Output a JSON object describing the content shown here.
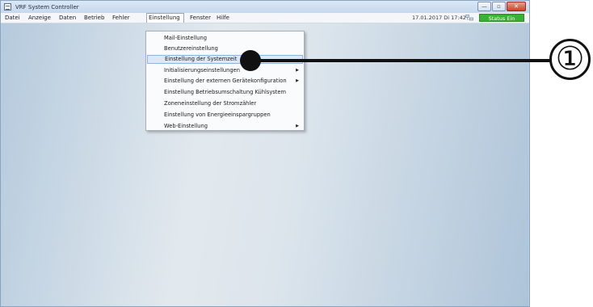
{
  "window": {
    "title": "VRF System Controller"
  },
  "window_controls": {
    "minimize": "—",
    "maximize": "▫",
    "close": "✕"
  },
  "menubar": {
    "items": [
      "Datei",
      "Anzeige",
      "Daten",
      "Betrieb",
      "Fehler",
      "Einstellung",
      "Fenster",
      "Hilfe"
    ],
    "open_item": "Einstellung"
  },
  "datetime": "17.01.2017 Di 17:42",
  "status": {
    "label": "Status Ein",
    "color": "#37b233"
  },
  "dropdown": {
    "items": [
      {
        "label": "Mail-Einstellung",
        "submenu": false
      },
      {
        "label": "Benutzereinstellung",
        "submenu": false
      },
      {
        "label": "Einstellung der Systemzeit",
        "submenu": false,
        "highlighted": true
      },
      {
        "label": "Initialisierungseinstellungen",
        "submenu": true
      },
      {
        "label": "Einstellung der externen Gerätekonfiguration",
        "submenu": true
      },
      {
        "label": "Einstellung Betriebsumschaltung Kühlsystem",
        "submenu": false
      },
      {
        "label": "Zoneneinstellung der Stromzähler",
        "submenu": false
      },
      {
        "label": "Einstellung von Energieeinspargruppen",
        "submenu": false
      },
      {
        "label": "Web-Einstellung",
        "submenu": true
      }
    ],
    "submenu_arrow": "▶"
  },
  "callout": {
    "label": "①"
  },
  "icons": {
    "app": "app-window-icon",
    "network": "network-icon"
  }
}
